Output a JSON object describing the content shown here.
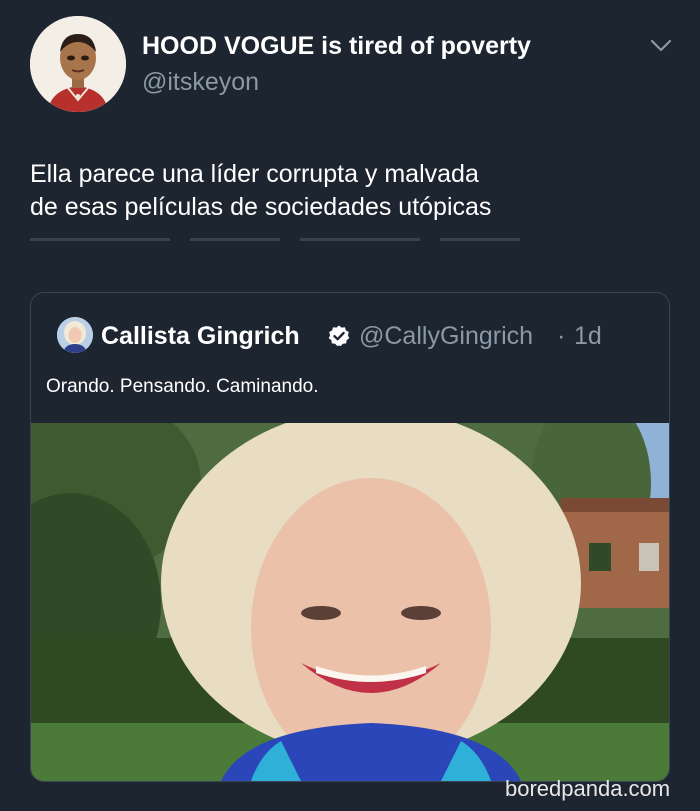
{
  "tweet": {
    "display_name": "HOOD VOGUE is tired of poverty",
    "handle": "@itskeyon",
    "text_line1": "Ella parece una líder corrupta y malvada",
    "text_line2": "de esas películas de sociedades utópicas",
    "icons": [
      "avatar-illustration",
      "chevron-down-icon"
    ]
  },
  "quoted_tweet": {
    "display_name": "Callista Gingrich",
    "handle": "@CallyGingrich",
    "separator": "·",
    "time": "1d",
    "text": "Orando. Pensando. Caminando.",
    "icons": [
      "verified-badge-icon"
    ]
  },
  "watermark": "boredpanda.com",
  "colors": {
    "background": "#1d2530",
    "text_primary": "#ffffff",
    "text_secondary": "#8b98a5",
    "card_border": "#3a4553"
  }
}
